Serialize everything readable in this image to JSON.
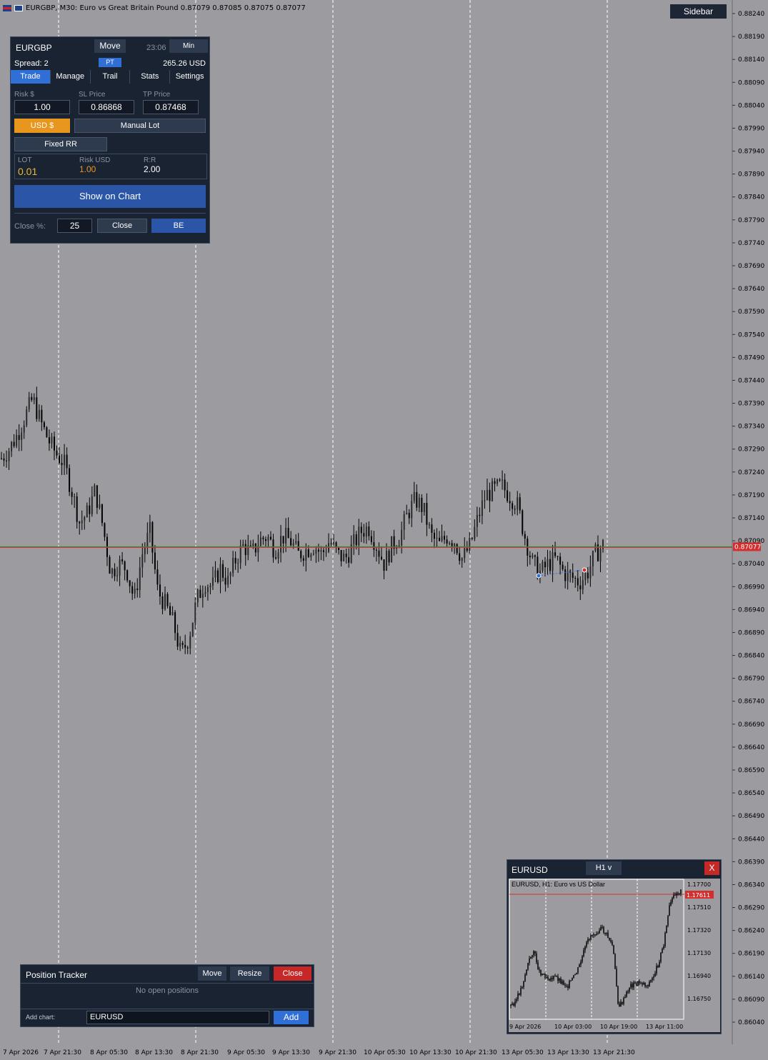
{
  "topbar": {
    "info": "EURGBP, M30:  Euro vs Great Britain Pound   0.87079 0.87085 0.87075 0.87077"
  },
  "sidebar_button": "Sidebar",
  "price_axis": [
    "0.88240",
    "0.88190",
    "0.88140",
    "0.88090",
    "0.88040",
    "0.87990",
    "0.87940",
    "0.87890",
    "0.87840",
    "0.87790",
    "0.87740",
    "0.87690",
    "0.87640",
    "0.87590",
    "0.87540",
    "0.87490",
    "0.87440",
    "0.87390",
    "0.87340",
    "0.87290",
    "0.87240",
    "0.87190",
    "0.87140",
    "0.87090",
    "0.87040",
    "0.86990",
    "0.86940",
    "0.86890",
    "0.86840",
    "0.86790",
    "0.86740",
    "0.86690",
    "0.86640",
    "0.86590",
    "0.86540",
    "0.86490",
    "0.86440",
    "0.86390",
    "0.86340",
    "0.86290",
    "0.86240",
    "0.86190",
    "0.86140",
    "0.86090",
    "0.86040"
  ],
  "current_price": "0.87077",
  "time_axis": [
    "7 Apr 2026",
    "7 Apr 21:30",
    "8 Apr 05:30",
    "8 Apr 13:30",
    "8 Apr 21:30",
    "9 Apr 05:30",
    "9 Apr 13:30",
    "9 Apr 21:30",
    "10 Apr 05:30",
    "10 Apr 13:30",
    "10 Apr 21:30",
    "13 Apr 05:30",
    "13 Apr 13:30",
    "13 Apr 21:30"
  ],
  "colors": {
    "chart_bg": "#9c9ba0",
    "panel_bg": "#1a2331",
    "accent_blue": "#2f6fd6",
    "accent_orange": "#e8961e",
    "danger": "#c62828",
    "bid_line": "#2e8b2e",
    "ask_line": "#d32f2f"
  },
  "chart_data": {
    "type": "candlestick",
    "symbol": "EURGBP",
    "timeframe": "M30",
    "ylim": [
      0.8604,
      0.8824
    ],
    "last": 0.87077,
    "close_path": [
      0.8727,
      0.8729,
      0.8732,
      0.8736,
      0.874,
      0.8735,
      0.8731,
      0.8728,
      0.8726,
      0.872,
      0.8713,
      0.8715,
      0.872,
      0.8712,
      0.8702,
      0.8704,
      0.8703,
      0.8696,
      0.8706,
      0.8711,
      0.8698,
      0.8695,
      0.8691,
      0.8684,
      0.8688,
      0.8696,
      0.87,
      0.8699,
      0.8703,
      0.87,
      0.8705,
      0.8708,
      0.8706,
      0.8709,
      0.871,
      0.8707,
      0.871,
      0.8709,
      0.8706,
      0.8707,
      0.8708,
      0.8706,
      0.8709,
      0.8706,
      0.8705,
      0.8708,
      0.8711,
      0.8712,
      0.8708,
      0.8704,
      0.8708,
      0.871,
      0.8715,
      0.8718,
      0.8716,
      0.871,
      0.8708,
      0.871,
      0.8709,
      0.8705,
      0.8708,
      0.8714,
      0.8719,
      0.872,
      0.8721,
      0.8719,
      0.8717,
      0.871,
      0.8704,
      0.8702,
      0.8704,
      0.8705,
      0.8702,
      0.8701,
      0.87,
      0.8702,
      0.8706,
      0.8708
    ]
  },
  "trade_panel": {
    "symbol": "EURGBP",
    "move": "Move",
    "time": "23:06",
    "min": "Min",
    "spread": "Spread: 2",
    "pt": "PT",
    "balance": "265.26 USD",
    "tabs": [
      "Trade",
      "Manage",
      "Trail",
      "Stats",
      "Settings"
    ],
    "risk_label": "Risk $",
    "risk_value": "1.00",
    "sl_label": "SL Price",
    "sl_value": "0.86868",
    "tp_label": "TP Price",
    "tp_value": "0.87468",
    "usd_button": "USD $",
    "manual_lot": "Manual Lot",
    "fixed_rr": "Fixed RR",
    "lot_label": "LOT",
    "lot_value": "0.01",
    "risk_usd_label": "Risk USD",
    "risk_usd_value": "1.00",
    "rr_label": "R:R",
    "rr_value": "2.00",
    "show_on_chart": "Show on Chart",
    "close_pct_label": "Close %:",
    "close_pct_value": "25",
    "close_button": "Close",
    "be_button": "BE"
  },
  "tracker": {
    "title": "Position Tracker",
    "move": "Move",
    "resize": "Resize",
    "close": "Close",
    "empty": "No open positions",
    "add_chart_label": "Add chart:",
    "add_chart_value": "EURUSD",
    "add_button": "Add"
  },
  "mini_chart": {
    "symbol": "EURUSD",
    "timeframe": "H1 v",
    "close": "X",
    "description": "EURUSD, H1:  Euro vs US Dollar",
    "price_axis": [
      "1.17700",
      "1.17510",
      "1.17320",
      "1.17130",
      "1.16940",
      "1.16750"
    ],
    "current_price": "1.17611",
    "time_axis": [
      "9 Apr 2026",
      "10 Apr 03:00",
      "10 Apr 19:00",
      "13 Apr 11:00"
    ]
  }
}
